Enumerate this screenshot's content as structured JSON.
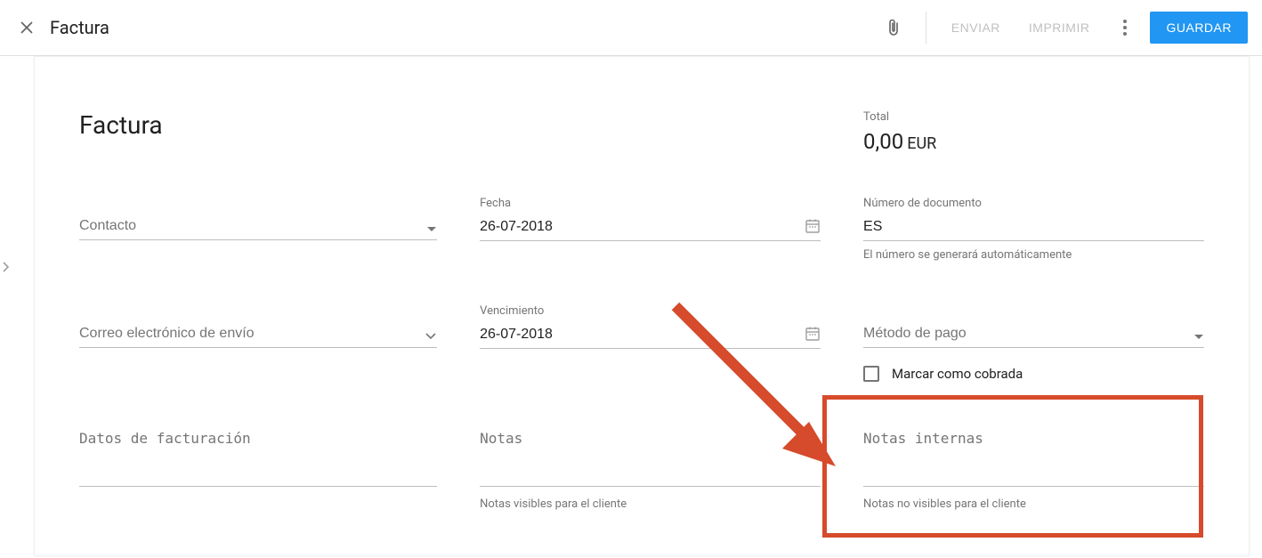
{
  "header": {
    "title": "Factura",
    "send": "ENVIAR",
    "print": "IMPRIMIR",
    "save": "GUARDAR"
  },
  "doc": {
    "heading": "Factura",
    "total_label": "Total",
    "total_value": "0,00",
    "total_currency": "EUR"
  },
  "fields": {
    "contact": {
      "placeholder": "Contacto"
    },
    "date": {
      "label": "Fecha",
      "value": "26-07-2018"
    },
    "doc_number": {
      "label": "Número de documento",
      "value": "ES",
      "helper": "El número se generará automáticamente"
    },
    "email": {
      "placeholder": "Correo electrónico de envío"
    },
    "due": {
      "label": "Vencimiento",
      "value": "26-07-2018"
    },
    "payment": {
      "placeholder": "Método de pago"
    },
    "mark_paid": {
      "label": "Marcar como cobrada"
    },
    "billing": {
      "placeholder": "Datos de facturación"
    },
    "notes": {
      "placeholder": "Notas",
      "helper": "Notas visibles para el cliente"
    },
    "internal_notes": {
      "placeholder": "Notas internas",
      "helper": "Notas no visibles para el cliente"
    }
  },
  "annotation": {
    "color": "#d64b2b"
  }
}
